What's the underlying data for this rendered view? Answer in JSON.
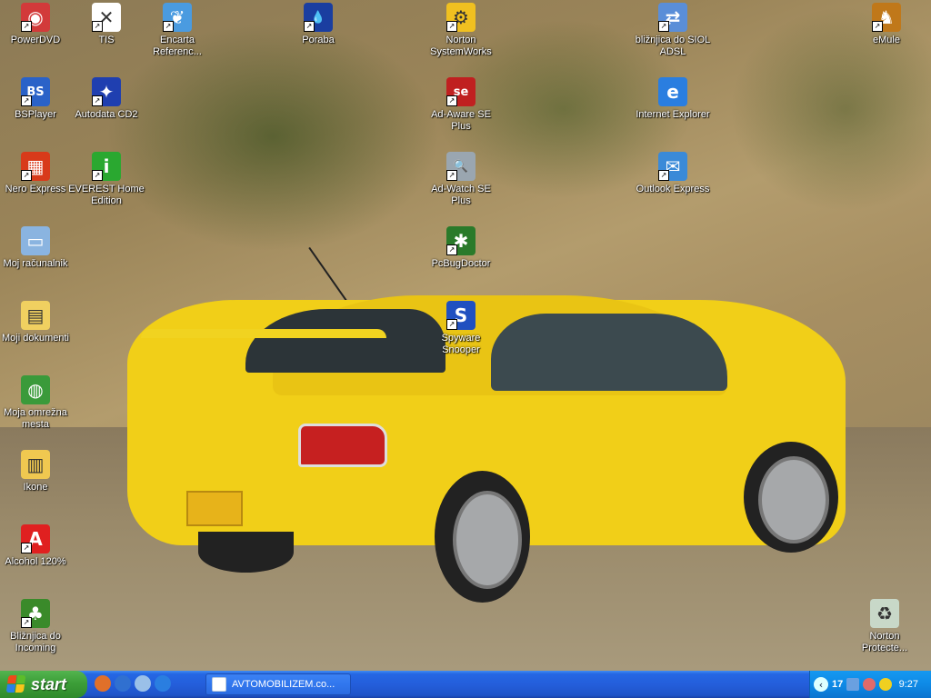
{
  "desktop": {
    "icons": [
      {
        "label": "PowerDVD",
        "icon": "powerdvd-icon",
        "color": "#d23a3a",
        "sym": "◉"
      },
      {
        "label": "TIS",
        "icon": "tis-icon",
        "color": "#ffffff",
        "sym": "✕"
      },
      {
        "label": "Encarta Referenc...",
        "icon": "encarta-icon",
        "color": "#4a9be0",
        "sym": "❦"
      },
      {
        "label": "Poraba",
        "icon": "poraba-icon",
        "color": "#1a3ea0",
        "sym": "💧"
      },
      {
        "label": "Norton SystemWorks",
        "icon": "norton-systemworks-icon",
        "color": "#f0c020",
        "sym": "⚙"
      },
      {
        "label": "bližnjica do SIOL ADSL",
        "icon": "network-connection-icon",
        "color": "#5a8ed8",
        "sym": "⇄"
      },
      {
        "label": "eMule",
        "icon": "emule-icon",
        "color": "#c0781a",
        "sym": "♞"
      },
      {
        "label": "BSPlayer",
        "icon": "bsplayer-icon",
        "color": "#2a62c8",
        "sym": "BS"
      },
      {
        "label": "Autodata CD2",
        "icon": "autodata-icon",
        "color": "#1f3fb0",
        "sym": "✦"
      },
      {
        "label": "Ad-Aware SE Plus",
        "icon": "ad-aware-icon",
        "color": "#c02020",
        "sym": "se"
      },
      {
        "label": "Internet Explorer",
        "icon": "internet-explorer-icon",
        "color": "#2a7ee0",
        "sym": "e"
      },
      {
        "label": "Nero Express",
        "icon": "nero-express-icon",
        "color": "#d83a1a",
        "sym": "▦"
      },
      {
        "label": "EVEREST Home Edition",
        "icon": "everest-icon",
        "color": "#2aa830",
        "sym": "i"
      },
      {
        "label": "Ad-Watch SE Plus",
        "icon": "ad-watch-icon",
        "color": "#9aa6b0",
        "sym": "🔍"
      },
      {
        "label": "Outlook Express",
        "icon": "outlook-express-icon",
        "color": "#3a8ad8",
        "sym": "✉"
      },
      {
        "label": "Moj računalnik",
        "icon": "my-computer-icon",
        "color": "#8ab4e0",
        "sym": "▭"
      },
      {
        "label": "PcBugDoctor",
        "icon": "pcbugdoctor-icon",
        "color": "#2a7a2a",
        "sym": "✱"
      },
      {
        "label": "Moji dokumenti",
        "icon": "my-documents-icon",
        "color": "#f0d060",
        "sym": "▤"
      },
      {
        "label": "Spyware Snooper",
        "icon": "spyware-snooper-icon",
        "color": "#2050c0",
        "sym": "S"
      },
      {
        "label": "Moja omrežna mesta",
        "icon": "my-network-places-icon",
        "color": "#3a9a3a",
        "sym": "◍"
      },
      {
        "label": "Ikone",
        "icon": "folder-icon",
        "color": "#f0c850",
        "sym": "▥"
      },
      {
        "label": "Alcohol 120%",
        "icon": "alcohol-120-icon",
        "color": "#e02020",
        "sym": "A"
      },
      {
        "label": "Bližnjica do Incoming",
        "icon": "tree-folder-icon",
        "color": "#3a8a2a",
        "sym": "♣"
      },
      {
        "label": "Norton Protecte...",
        "icon": "recycle-bin-icon",
        "color": "#c8d8c8",
        "sym": "♻"
      }
    ]
  },
  "taskbar": {
    "start_label": "start",
    "quick_launch": [
      {
        "icon": "firefox-icon",
        "color": "#e0702a"
      },
      {
        "icon": "media-player-icon",
        "color": "#3070d0"
      },
      {
        "icon": "show-desktop-icon",
        "color": "#9ac0e8"
      },
      {
        "icon": "internet-explorer-icon",
        "color": "#2a7ee0"
      }
    ],
    "task_button_label": "AVTOMOBILIZEM.co...",
    "tray": {
      "badge_count": "17",
      "clock": "9:27"
    }
  }
}
